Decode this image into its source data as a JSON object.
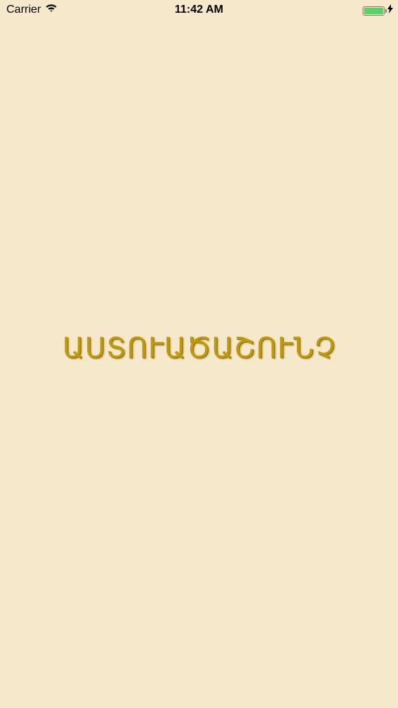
{
  "status_bar": {
    "carrier": "Carrier",
    "time": "11:42 AM",
    "battery_color": "#4cd964",
    "wifi_icon": "wifi-icon",
    "charging_icon": "charging-bolt-icon"
  },
  "main": {
    "title": "ԱՍՏՈՒԱԾԱՇՈՒՆՉ",
    "title_color": "#c09a07",
    "background_color": "#f6e8cb"
  }
}
